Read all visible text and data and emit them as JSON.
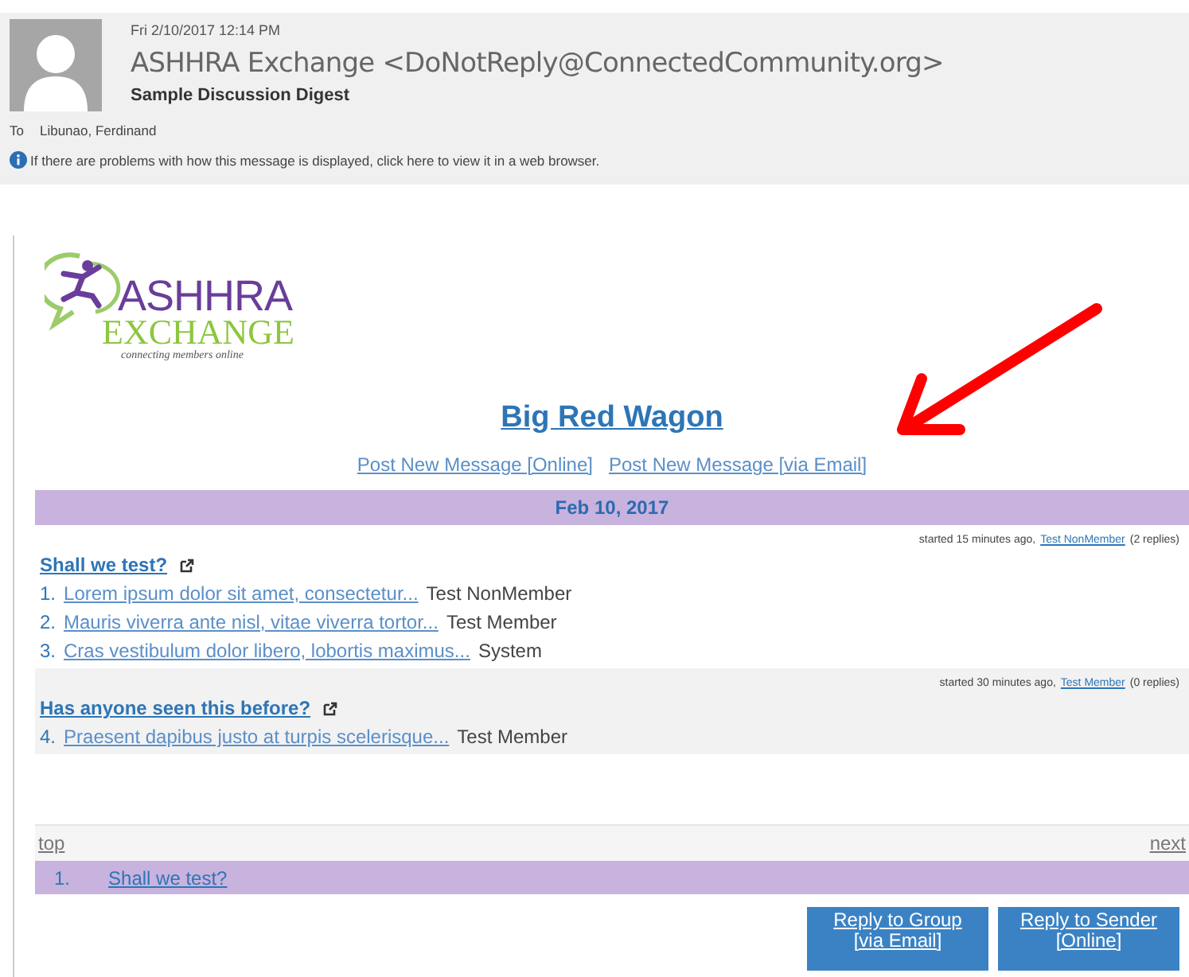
{
  "message": {
    "date": "Fri 2/10/2017 12:14 PM",
    "sender": "ASHHRA Exchange <DoNotReply@ConnectedCommunity.org>",
    "subject": "Sample Discussion Digest",
    "to_label": "To",
    "to": "Libunao, Ferdinand",
    "info": "If there are problems with how this message is displayed, click here to view it in a web browser."
  },
  "logo": {
    "line_1": "ASHHRA",
    "line_2": "EXCHANGE",
    "tagline": "connecting members online"
  },
  "digest": {
    "title": "Big Red Wagon",
    "post_links": [
      "Post New Message [Online]",
      "Post New Message [via Email]"
    ],
    "date_bar": "Feb 10, 2017"
  },
  "threads": [
    {
      "meta_prefix": "started 15 minutes ago,",
      "author": "Test NonMember",
      "replies": "(2 replies)",
      "title": "Shall we test?",
      "shaded": false,
      "posts": [
        {
          "number": "1.",
          "excerpt": "Lorem ipsum dolor sit amet, consectetur...",
          "author": "Test NonMember"
        },
        {
          "number": "2.",
          "excerpt": "Mauris viverra ante nisl, vitae viverra tortor...",
          "author": "Test Member"
        },
        {
          "number": "3.",
          "excerpt": "Cras vestibulum dolor libero, lobortis maximus...",
          "author": "System"
        }
      ]
    },
    {
      "meta_prefix": "started 30 minutes ago,",
      "author": "Test Member",
      "replies": "(0 replies)",
      "title": "Has anyone seen this before?",
      "shaded": true,
      "posts": [
        {
          "number": "4.",
          "excerpt": "Praesent dapibus justo at turpis scelerisque...",
          "author": "Test Member"
        }
      ]
    }
  ],
  "footer": {
    "top": "top",
    "next": "next",
    "index": [
      {
        "number": "1.",
        "title": "Shall we test?"
      }
    ],
    "buttons": [
      {
        "line_1": "Reply to Group",
        "line_2": "[via Email]"
      },
      {
        "line_1": "Reply to Sender",
        "line_2": "[Online]"
      }
    ]
  }
}
